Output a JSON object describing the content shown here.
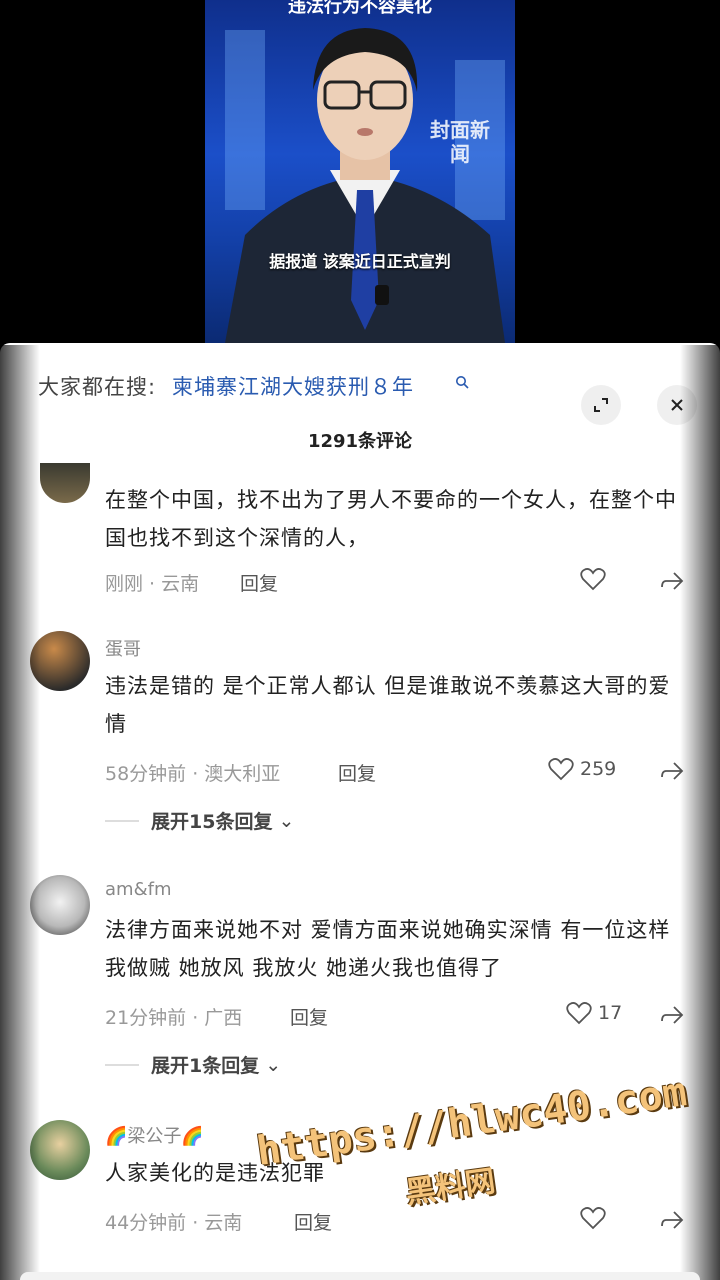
{
  "video": {
    "top_caption": "违法行为不容美化",
    "logo_text": "封面新闻",
    "subtitle": "据报道 该案近日正式宣判"
  },
  "search": {
    "prefix": "大家都在搜:",
    "term": "柬埔寨江湖大嫂获刑８年"
  },
  "comments_header": {
    "count": "1291条评论"
  },
  "comments": [
    {
      "username": "",
      "text": "在整个中国，找不出为了男人不要命的一个女人，在整个中国也找不到这个深情的人，",
      "time_location": "刚刚 · 云南",
      "reply": "回复",
      "likes": ""
    },
    {
      "username": "蛋哥",
      "text": "违法是错的 是个正常人都认 但是谁敢说不羡慕这大哥的爱情",
      "time_location": "58分钟前 · 澳大利亚",
      "reply": "回复",
      "likes": "259",
      "expand": "展开15条回复"
    },
    {
      "username": "am&fm",
      "text": "法律方面来说她不对 爱情方面来说她确实深情 有一位这样我做贼 她放风 我放火 她递火我也值得了",
      "time_location": "21分钟前 · 广西",
      "reply": "回复",
      "likes": "17",
      "expand": "展开1条回复"
    },
    {
      "username": "🌈梁公子🌈",
      "text": "人家美化的是违法犯罪",
      "time_location": "44分钟前 · 云南",
      "reply": "回复",
      "likes": ""
    }
  ],
  "watermark": {
    "url": "https://hlwc40.com",
    "name": "黑料网"
  },
  "colors": {
    "link": "#2a5bb0",
    "panel_bg": "#ffffff",
    "video_bg": "#1b4fc9"
  }
}
